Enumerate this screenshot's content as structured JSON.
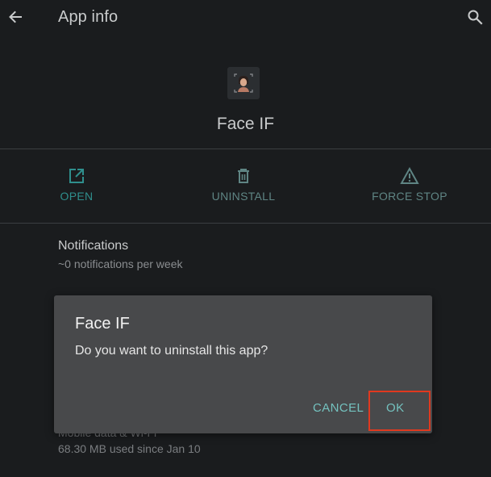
{
  "header": {
    "title": "App info",
    "back_icon": "arrow-left-icon",
    "search_icon": "search-icon"
  },
  "app": {
    "name": "Face IF",
    "icon": "face-app-icon"
  },
  "actions": [
    {
      "label": "OPEN",
      "icon": "open-external-icon"
    },
    {
      "label": "UNINSTALL",
      "icon": "trash-icon"
    },
    {
      "label": "FORCE STOP",
      "icon": "warning-icon"
    }
  ],
  "settings": [
    {
      "title": "Notifications",
      "subtitle": "~0 notifications per week"
    },
    {
      "title": "Mobile data & Wi-Fi",
      "subtitle": "68.30 MB used since Jan 10"
    }
  ],
  "dialog": {
    "title": "Face IF",
    "message": "Do you want to uninstall this app?",
    "cancel_label": "CANCEL",
    "ok_label": "OK"
  },
  "colors": {
    "background": "#1a1c1e",
    "accent": "#2f8f8d",
    "dialog_bg": "#48494b",
    "dialog_button": "#74c2bf",
    "highlight": "#e0391f"
  }
}
